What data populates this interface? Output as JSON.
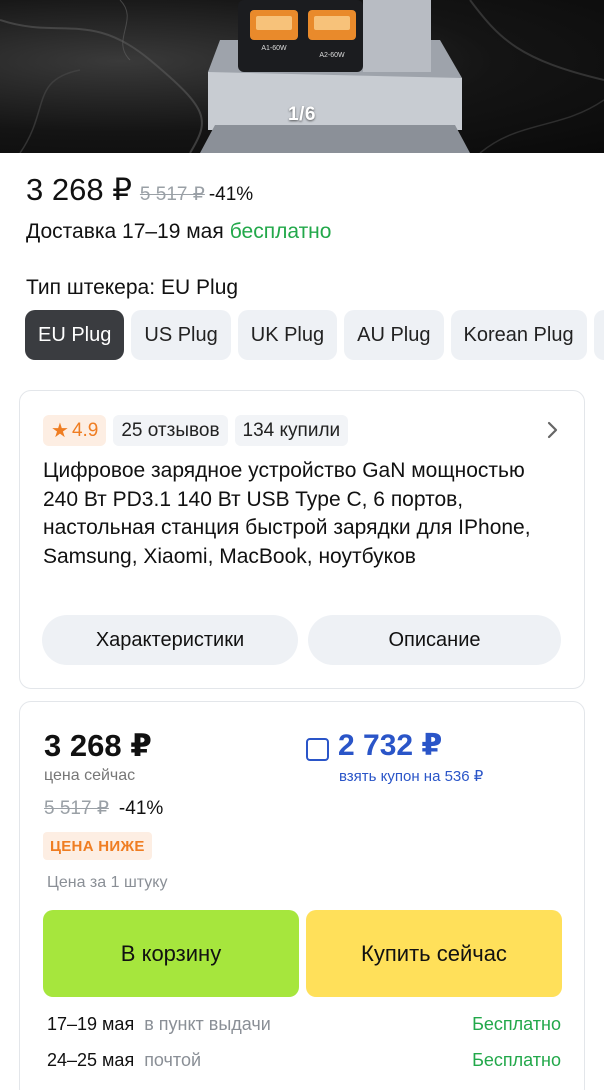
{
  "gallery": {
    "counter": "1/6",
    "port_labels": [
      "A1-60W",
      "A2-60W"
    ]
  },
  "product": {
    "price": "3 268 ₽",
    "old_price": "5 517 ₽",
    "discount": "-41%",
    "delivery": {
      "text": "Доставка 17–19 мая",
      "free": "бесплатно"
    },
    "plug": {
      "label": "Тип штекера:",
      "selected": "EU Plug",
      "options": [
        "EU Plug",
        "US Plug",
        "UK Plug",
        "AU Plug",
        "Korean Plug",
        ""
      ]
    }
  },
  "info_card": {
    "rating": "4.9",
    "reviews": "25 отзывов",
    "purchases": "134 купили",
    "title": "Цифровое зарядное устройство GaN мощностью 240 Вт PD3.1 140 Вт USB Type C, 6 портов, настольная станция быстрой зарядки для IPhone, Samsung, Xiaomi, MacBook, ноутбуков",
    "buttons": {
      "specs": "Характеристики",
      "description": "Описание"
    }
  },
  "buy_card": {
    "price": "3 268 ₽",
    "price_label": "цена сейчас",
    "old_price": "5 517 ₽",
    "discount": "-41%",
    "lower_badge": "ЦЕНА НИЖЕ",
    "unit_note": "Цена за 1 штуку",
    "coupon": {
      "price": "2 732 ₽",
      "label": "взять купон на 536 ₽",
      "checked": false
    },
    "cart_button": "В корзину",
    "buy_now_button": "Купить сейчас",
    "delivery_options": [
      {
        "dates": "17–19 мая",
        "method": "в пункт выдачи",
        "cost": "Бесплатно"
      },
      {
        "dates": "24–25 мая",
        "method": "почтой",
        "cost": "Бесплатно"
      }
    ]
  },
  "colors": {
    "accent_green": "#22a84a",
    "coupon_blue": "#2a55c8",
    "rating_orange": "#ef7d22",
    "cart_green": "#a6e63d",
    "buy_yellow": "#ffe05a"
  }
}
